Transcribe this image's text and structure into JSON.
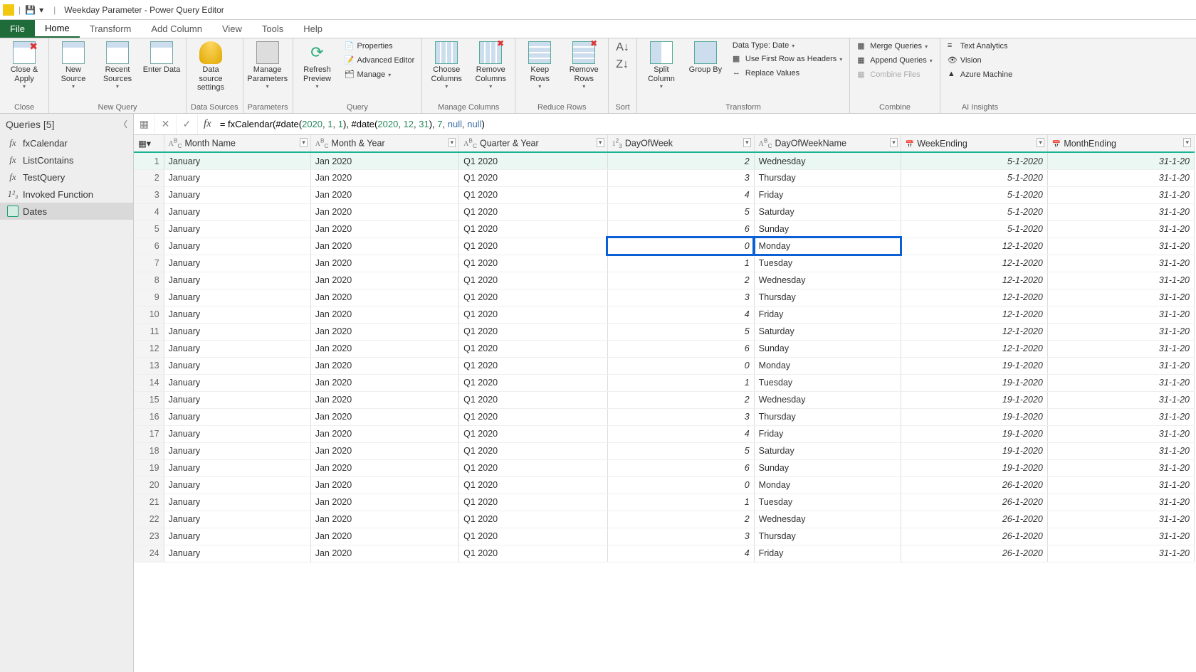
{
  "titlebar": {
    "title": "Weekday Parameter - Power Query Editor"
  },
  "menu": {
    "file": "File",
    "home": "Home",
    "transform": "Transform",
    "addcol": "Add Column",
    "view": "View",
    "tools": "Tools",
    "help": "Help"
  },
  "ribbon": {
    "close_apply": "Close &\nApply",
    "new_source": "New\nSource",
    "recent_sources": "Recent\nSources",
    "enter_data": "Enter\nData",
    "data_source_settings": "Data source\nsettings",
    "manage_params": "Manage\nParameters",
    "refresh_preview": "Refresh\nPreview",
    "properties": "Properties",
    "advanced_editor": "Advanced Editor",
    "manage": "Manage",
    "choose_cols": "Choose\nColumns",
    "remove_cols": "Remove\nColumns",
    "keep_rows": "Keep\nRows",
    "remove_rows": "Remove\nRows",
    "split_col": "Split\nColumn",
    "group_by": "Group\nBy",
    "data_type": "Data Type: Date",
    "use_first_row": "Use First Row as Headers",
    "replace_values": "Replace Values",
    "merge_q": "Merge Queries",
    "append_q": "Append Queries",
    "combine_files": "Combine Files",
    "text_analytics": "Text Analytics",
    "vision": "Vision",
    "azure_ml": "Azure Machine",
    "grp_close": "Close",
    "grp_newquery": "New Query",
    "grp_ds": "Data Sources",
    "grp_params": "Parameters",
    "grp_query": "Query",
    "grp_cols": "Manage Columns",
    "grp_rows": "Reduce Rows",
    "grp_sort": "Sort",
    "grp_transform": "Transform",
    "grp_combine": "Combine",
    "grp_ai": "AI Insights"
  },
  "sidebar": {
    "header": "Queries [5]",
    "items": [
      {
        "icon": "fx",
        "label": "fxCalendar"
      },
      {
        "icon": "fx",
        "label": "ListContains"
      },
      {
        "icon": "fx",
        "label": "TestQuery"
      },
      {
        "icon": "123",
        "label": "Invoked Function"
      },
      {
        "icon": "tbl",
        "label": "Dates"
      }
    ]
  },
  "formula": {
    "prefix": "= fxCalendar(#date(",
    "y1": "2020",
    "c1": ", ",
    "m1": "1",
    "c1b": ", ",
    "d1": "1",
    "mid": "), #date(",
    "y2": "2020",
    "c2": ", ",
    "m2": "12",
    "c2b": ", ",
    "d2": "31",
    "mid2": "), ",
    "arg": "7",
    "c3": ", ",
    "n1": "null",
    "c4": ", ",
    "n2": "null",
    "end": ")"
  },
  "columns": [
    "Month Name",
    "Month & Year",
    "Quarter & Year",
    "DayOfWeek",
    "DayOfWeekName",
    "WeekEnding",
    "MonthEnding"
  ],
  "coltypes": [
    "ABC",
    "ABC",
    "ABC",
    "123",
    "ABC",
    "date",
    "date"
  ],
  "rows": [
    {
      "n": 1,
      "m": "January",
      "my": "Jan 2020",
      "qy": "Q1 2020",
      "dow": "2",
      "down": "Wednesday",
      "we": "5-1-2020",
      "me": "31-1-20"
    },
    {
      "n": 2,
      "m": "January",
      "my": "Jan 2020",
      "qy": "Q1 2020",
      "dow": "3",
      "down": "Thursday",
      "we": "5-1-2020",
      "me": "31-1-20"
    },
    {
      "n": 3,
      "m": "January",
      "my": "Jan 2020",
      "qy": "Q1 2020",
      "dow": "4",
      "down": "Friday",
      "we": "5-1-2020",
      "me": "31-1-20"
    },
    {
      "n": 4,
      "m": "January",
      "my": "Jan 2020",
      "qy": "Q1 2020",
      "dow": "5",
      "down": "Saturday",
      "we": "5-1-2020",
      "me": "31-1-20"
    },
    {
      "n": 5,
      "m": "January",
      "my": "Jan 2020",
      "qy": "Q1 2020",
      "dow": "6",
      "down": "Sunday",
      "we": "5-1-2020",
      "me": "31-1-20"
    },
    {
      "n": 6,
      "m": "January",
      "my": "Jan 2020",
      "qy": "Q1 2020",
      "dow": "0",
      "down": "Monday",
      "we": "12-1-2020",
      "me": "31-1-20",
      "hl": true
    },
    {
      "n": 7,
      "m": "January",
      "my": "Jan 2020",
      "qy": "Q1 2020",
      "dow": "1",
      "down": "Tuesday",
      "we": "12-1-2020",
      "me": "31-1-20"
    },
    {
      "n": 8,
      "m": "January",
      "my": "Jan 2020",
      "qy": "Q1 2020",
      "dow": "2",
      "down": "Wednesday",
      "we": "12-1-2020",
      "me": "31-1-20"
    },
    {
      "n": 9,
      "m": "January",
      "my": "Jan 2020",
      "qy": "Q1 2020",
      "dow": "3",
      "down": "Thursday",
      "we": "12-1-2020",
      "me": "31-1-20"
    },
    {
      "n": 10,
      "m": "January",
      "my": "Jan 2020",
      "qy": "Q1 2020",
      "dow": "4",
      "down": "Friday",
      "we": "12-1-2020",
      "me": "31-1-20"
    },
    {
      "n": 11,
      "m": "January",
      "my": "Jan 2020",
      "qy": "Q1 2020",
      "dow": "5",
      "down": "Saturday",
      "we": "12-1-2020",
      "me": "31-1-20"
    },
    {
      "n": 12,
      "m": "January",
      "my": "Jan 2020",
      "qy": "Q1 2020",
      "dow": "6",
      "down": "Sunday",
      "we": "12-1-2020",
      "me": "31-1-20"
    },
    {
      "n": 13,
      "m": "January",
      "my": "Jan 2020",
      "qy": "Q1 2020",
      "dow": "0",
      "down": "Monday",
      "we": "19-1-2020",
      "me": "31-1-20"
    },
    {
      "n": 14,
      "m": "January",
      "my": "Jan 2020",
      "qy": "Q1 2020",
      "dow": "1",
      "down": "Tuesday",
      "we": "19-1-2020",
      "me": "31-1-20"
    },
    {
      "n": 15,
      "m": "January",
      "my": "Jan 2020",
      "qy": "Q1 2020",
      "dow": "2",
      "down": "Wednesday",
      "we": "19-1-2020",
      "me": "31-1-20"
    },
    {
      "n": 16,
      "m": "January",
      "my": "Jan 2020",
      "qy": "Q1 2020",
      "dow": "3",
      "down": "Thursday",
      "we": "19-1-2020",
      "me": "31-1-20"
    },
    {
      "n": 17,
      "m": "January",
      "my": "Jan 2020",
      "qy": "Q1 2020",
      "dow": "4",
      "down": "Friday",
      "we": "19-1-2020",
      "me": "31-1-20"
    },
    {
      "n": 18,
      "m": "January",
      "my": "Jan 2020",
      "qy": "Q1 2020",
      "dow": "5",
      "down": "Saturday",
      "we": "19-1-2020",
      "me": "31-1-20"
    },
    {
      "n": 19,
      "m": "January",
      "my": "Jan 2020",
      "qy": "Q1 2020",
      "dow": "6",
      "down": "Sunday",
      "we": "19-1-2020",
      "me": "31-1-20"
    },
    {
      "n": 20,
      "m": "January",
      "my": "Jan 2020",
      "qy": "Q1 2020",
      "dow": "0",
      "down": "Monday",
      "we": "26-1-2020",
      "me": "31-1-20"
    },
    {
      "n": 21,
      "m": "January",
      "my": "Jan 2020",
      "qy": "Q1 2020",
      "dow": "1",
      "down": "Tuesday",
      "we": "26-1-2020",
      "me": "31-1-20"
    },
    {
      "n": 22,
      "m": "January",
      "my": "Jan 2020",
      "qy": "Q1 2020",
      "dow": "2",
      "down": "Wednesday",
      "we": "26-1-2020",
      "me": "31-1-20"
    },
    {
      "n": 23,
      "m": "January",
      "my": "Jan 2020",
      "qy": "Q1 2020",
      "dow": "3",
      "down": "Thursday",
      "we": "26-1-2020",
      "me": "31-1-20"
    },
    {
      "n": 24,
      "m": "January",
      "my": "Jan 2020",
      "qy": "Q1 2020",
      "dow": "4",
      "down": "Friday",
      "we": "26-1-2020",
      "me": "31-1-20"
    }
  ]
}
